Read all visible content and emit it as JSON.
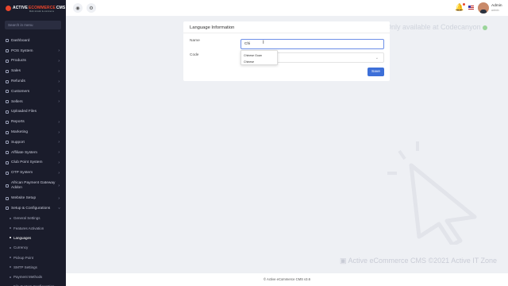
{
  "logo": {
    "text_a": "ACTIVE",
    "text_b": "ECOMMERCE",
    "text_c": "CMS",
    "tagline": "Multi-Vendor E-commerce"
  },
  "search": {
    "placeholder": "Search in menu"
  },
  "sidebar": {
    "items": [
      {
        "label": "Dashboard",
        "icon": "home-icon",
        "chevron": false
      },
      {
        "label": "POS System",
        "icon": "pos-icon",
        "chevron": true
      },
      {
        "label": "Products",
        "icon": "box-icon",
        "chevron": true
      },
      {
        "label": "Sales",
        "icon": "money-icon",
        "chevron": true
      },
      {
        "label": "Refunds",
        "icon": "backward-icon",
        "chevron": true
      },
      {
        "label": "Customers",
        "icon": "users-icon",
        "chevron": true
      },
      {
        "label": "Sellers",
        "icon": "user-icon",
        "chevron": true
      },
      {
        "label": "Uploaded Files",
        "icon": "folder-icon",
        "chevron": false
      },
      {
        "label": "Reports",
        "icon": "file-icon",
        "chevron": true
      },
      {
        "label": "Marketing",
        "icon": "bullhorn-icon",
        "chevron": true
      },
      {
        "label": "Support",
        "icon": "link-icon",
        "chevron": true
      },
      {
        "label": "Affiliate System",
        "icon": "link-icon",
        "chevron": true
      },
      {
        "label": "Club Point System",
        "icon": "coin-icon",
        "chevron": true
      },
      {
        "label": "OTP System",
        "icon": "phone-icon",
        "chevron": true
      },
      {
        "label": "African Payment Gateway Addon",
        "icon": "card-icon",
        "chevron": true,
        "tall": true
      },
      {
        "label": "Website Setup",
        "icon": "desktop-icon",
        "chevron": true
      },
      {
        "label": "Setup & Configurations",
        "icon": "dashboard-icon",
        "chevron": true,
        "open": true
      }
    ],
    "subitems": [
      {
        "label": "General Settings"
      },
      {
        "label": "Features Activation"
      },
      {
        "label": "Languages",
        "active": true
      },
      {
        "label": "Currency"
      },
      {
        "label": "Pickup Point"
      },
      {
        "label": "SMTP Settings"
      },
      {
        "label": "Payment Methods"
      },
      {
        "label": "File System Configuration"
      }
    ]
  },
  "topbar": {
    "user_name": "Admin",
    "user_role": "admin"
  },
  "form": {
    "title": "Language Information",
    "name_label": "Name",
    "name_value": "Chi",
    "code_label": "Code",
    "dropdown_options": [
      "Chinese Guan",
      "Chinese"
    ],
    "save_label": "Save"
  },
  "watermark": {
    "top": "Only available at Codecanyon",
    "bottom": "Active eCommerce CMS  ©2021 Active IT Zone"
  },
  "footer": {
    "text": "© Active eCommerce CMS v3.6"
  }
}
